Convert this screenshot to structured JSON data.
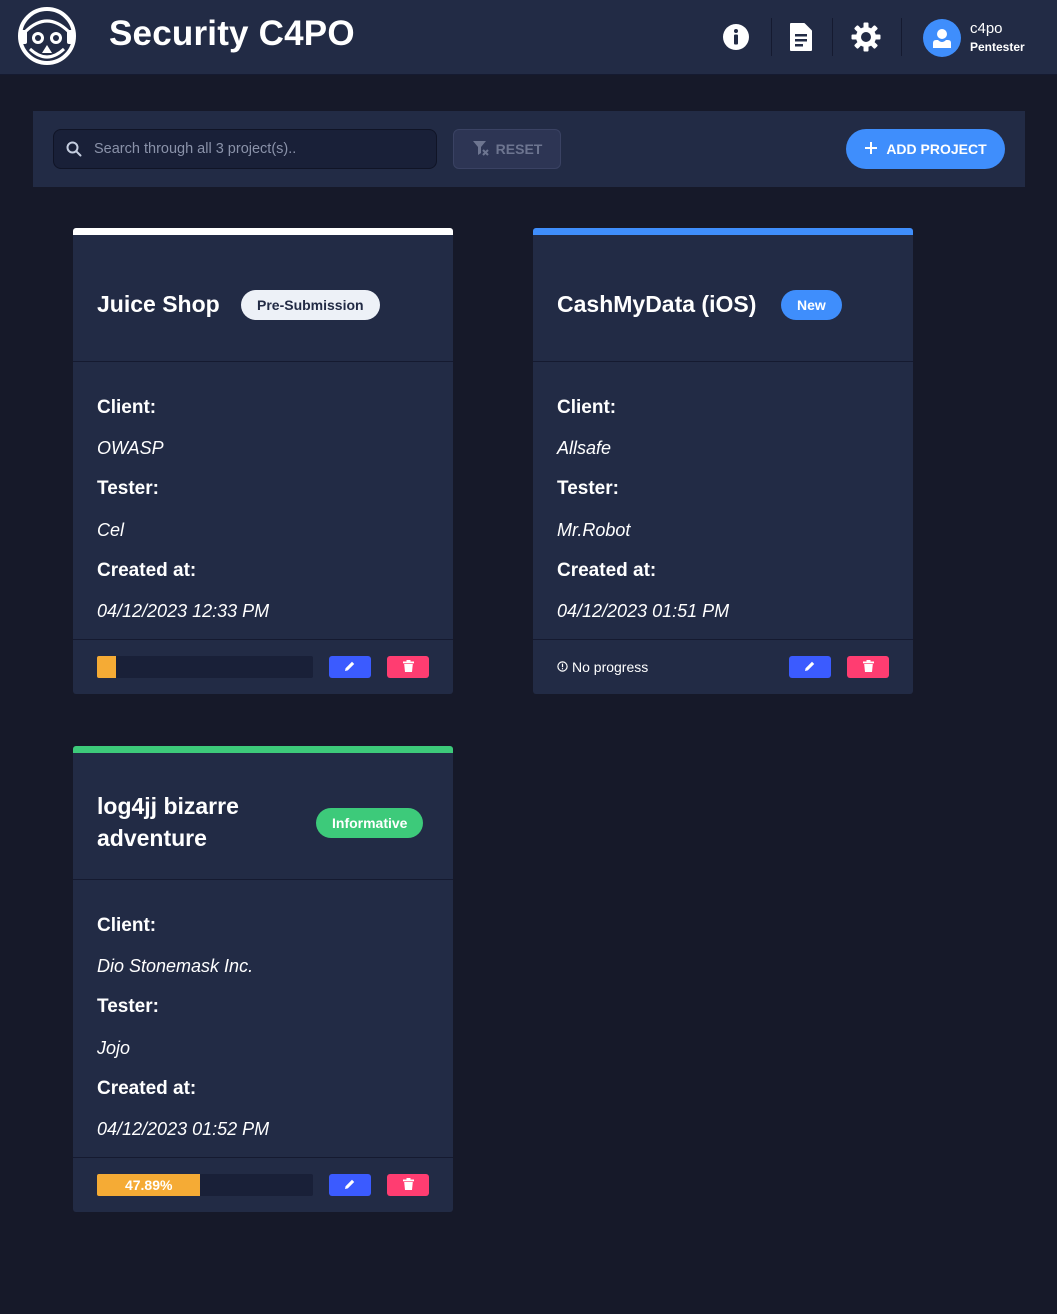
{
  "app": {
    "title": "Security C4PO"
  },
  "user": {
    "name": "c4po",
    "role": "Pentester"
  },
  "toolbar": {
    "search_placeholder": "Search through all 3 project(s)..",
    "search_value": "",
    "reset_label": "RESET",
    "add_label": "ADD PROJECT"
  },
  "labels": {
    "client": "Client:",
    "tester": "Tester:",
    "created": "Created at:"
  },
  "projects": [
    {
      "title": "Juice Shop",
      "status": "Pre-Submission",
      "accent_color": "#ffffff",
      "badge_bg": "#edf1f7",
      "badge_fg": "#222b45",
      "client": "OWASP",
      "tester": "Cel",
      "created_at": "04/12/2023 12:33 PM",
      "progress": 9,
      "progress_label": ""
    },
    {
      "title": "CashMyData (iOS)",
      "status": "New",
      "accent_color": "#3f8efc",
      "badge_bg": "#3f8efc",
      "badge_fg": "#ffffff",
      "client": "Allsafe",
      "tester": "Mr.Robot",
      "created_at": "04/12/2023 01:51 PM",
      "progress": null,
      "progress_label": "No progress"
    },
    {
      "title": "log4jj bizarre adventure",
      "title_line1": "log4jj bizarre",
      "title_line2": "adventure",
      "status": "Informative",
      "accent_color": "#3dca7a",
      "badge_bg": "#3dca7a",
      "badge_fg": "#ffffff",
      "client": "Dio Stonemask Inc.",
      "tester": "Jojo",
      "created_at": "04/12/2023 01:52 PM",
      "progress": 47.89,
      "progress_label": "47.89%"
    }
  ],
  "icons": {
    "logo": "robot-logo-icon",
    "info": "info-icon",
    "report": "document-icon",
    "settings": "gear-icon",
    "avatar": "user-avatar-icon",
    "search": "search-icon",
    "reset": "filter-off-icon",
    "add": "plus-icon",
    "edit": "pencil-icon",
    "delete": "trash-icon",
    "no_progress": "exclamation-circle-icon"
  },
  "colors": {
    "background": "#161929",
    "surface": "#222b45",
    "primary": "#3f8efc",
    "edit": "#3b5bff",
    "delete": "#ff3d71",
    "progress": "#f5ab35"
  }
}
